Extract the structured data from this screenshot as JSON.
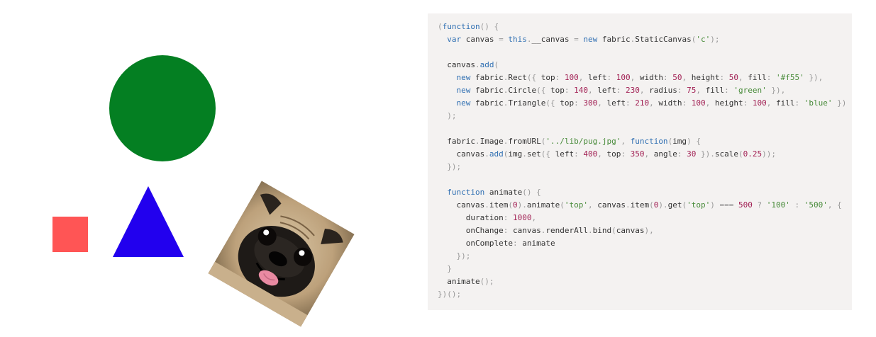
{
  "canvas": {
    "rect": {
      "fill": "#f55"
    },
    "circle": {
      "fill": "green",
      "color": "#047f22"
    },
    "triangle": {
      "fill": "blue",
      "color": "#2200ee"
    },
    "image": {
      "subject": "pug photo",
      "icon": "pug-image"
    }
  },
  "code": {
    "language": "javascript",
    "lines": [
      "(function() {",
      "  var canvas = this.__canvas = new fabric.StaticCanvas('c');",
      "",
      "  canvas.add(",
      "    new fabric.Rect({ top: 100, left: 100, width: 50, height: 50, fill: '#f55' }),",
      "    new fabric.Circle({ top: 140, left: 230, radius: 75, fill: 'green' }),",
      "    new fabric.Triangle({ top: 300, left: 210, width: 100, height: 100, fill: 'blue' })",
      "  );",
      "",
      "  fabric.Image.fromURL('../lib/pug.jpg', function(img) {",
      "    canvas.add(img.set({ left: 400, top: 350, angle: 30 }).scale(0.25));",
      "  });",
      "",
      "  function animate() {",
      "    canvas.item(0).animate('top', canvas.item(0).get('top') === 500 ? '100' : '500', {",
      "      duration: 1000,",
      "      onChange: canvas.renderAll.bind(canvas),",
      "      onComplete: animate",
      "    });",
      "  }",
      "  animate();",
      "})();"
    ]
  }
}
